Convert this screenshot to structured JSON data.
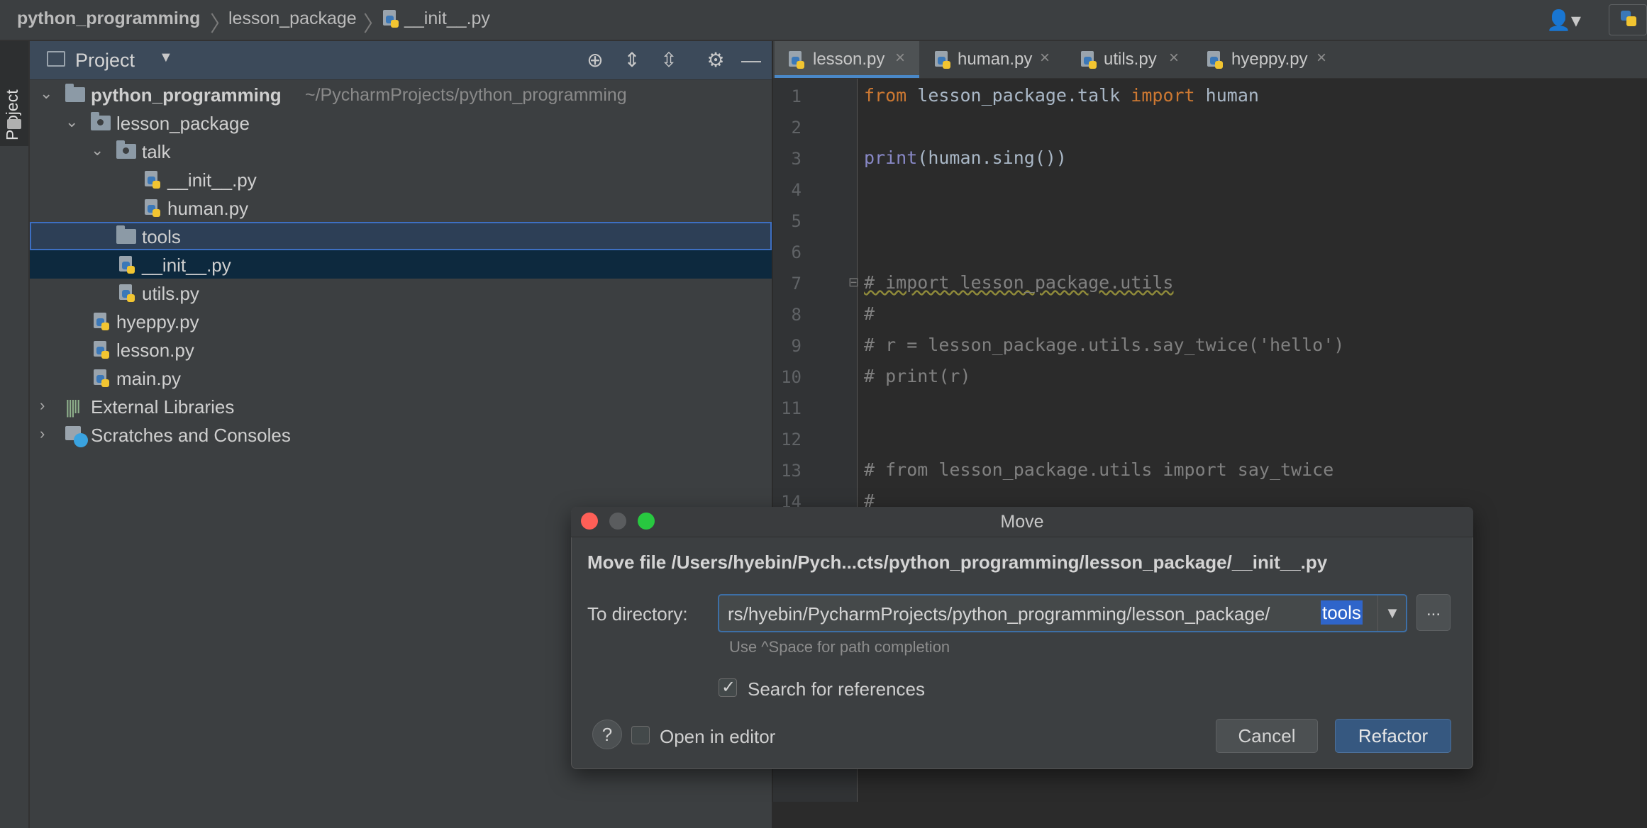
{
  "breadcrumb": [
    "python_programming",
    "lesson_package",
    "__init__.py"
  ],
  "side_tab": "Project",
  "project": {
    "title": "Project",
    "tree": [
      {
        "label": "python_programming",
        "sub": "~/PycharmProjects/python_programming"
      },
      {
        "label": "lesson_package"
      },
      {
        "label": "talk"
      },
      {
        "label": "__init__.py"
      },
      {
        "label": "human.py"
      },
      {
        "label": "tools"
      },
      {
        "label": "__init__.py"
      },
      {
        "label": "utils.py"
      },
      {
        "label": "hyeppy.py"
      },
      {
        "label": "lesson.py"
      },
      {
        "label": "main.py"
      },
      {
        "label": "External Libraries"
      },
      {
        "label": "Scratches and Consoles"
      }
    ]
  },
  "tabs": [
    "lesson.py",
    "human.py",
    "utils.py",
    "hyeppy.py"
  ],
  "editor": {
    "line_numbers": [
      "1",
      "2",
      "3",
      "4",
      "5",
      "6",
      "7",
      "8",
      "9",
      "10",
      "11",
      "12",
      "13",
      "14"
    ],
    "line1": {
      "kw1": "from",
      "mod": " lesson_package.talk ",
      "kw2": "import",
      "name": " human"
    },
    "line3": {
      "fn": "print",
      "rest": "(human.sing())"
    },
    "line7": "# import lesson_package.utils",
    "line8": "#",
    "line9": "# r = lesson_package.utils.say_twice('hello')",
    "line10": "# print(r)",
    "line13": "# from lesson_package.utils import say_twice",
    "line14": "#"
  },
  "dialog": {
    "title": "Move",
    "heading": "Move file /Users/hyebin/Pych...cts/python_programming/lesson_package/__init__.py",
    "to_directory_label": "To directory:",
    "directory_value": "rs/hyebin/PycharmProjects/python_programming/lesson_package/",
    "directory_selected": "tools",
    "browse_label": "...",
    "hint": "Use ^Space for path completion",
    "search_refs_label": "Search for references",
    "open_editor_label": "Open in editor",
    "help_label": "?",
    "cancel_label": "Cancel",
    "refactor_label": "Refactor"
  },
  "colors": {
    "keyword": "#cc7832",
    "builtin": "#8888c6",
    "comment": "#808080",
    "selection": "#0d293e",
    "accent": "#365880"
  }
}
